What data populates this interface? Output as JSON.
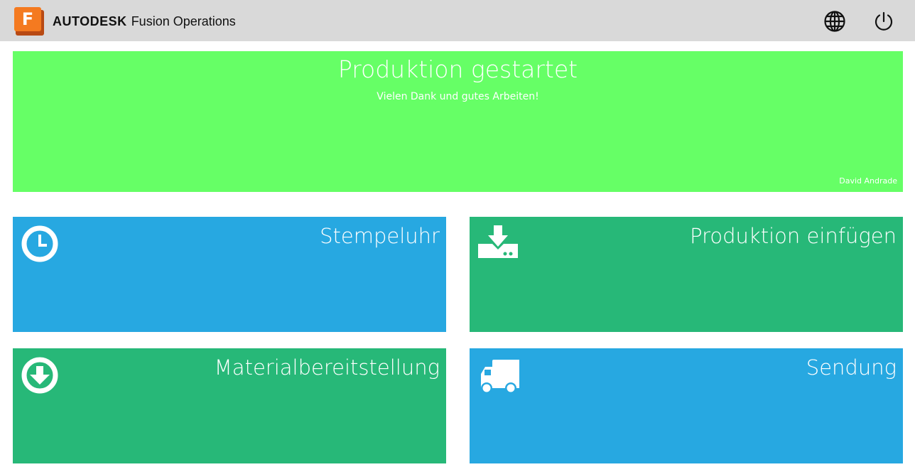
{
  "header": {
    "logo_letter": "F",
    "brand": "AUTODESK",
    "product": "Fusion Operations",
    "icons": [
      "globe-icon",
      "power-icon"
    ]
  },
  "banner": {
    "title": "Produktion gestartet",
    "subtitle": "Vielen Dank und gutes Arbeiten!",
    "user": "David Andrade",
    "color": "#66ff66"
  },
  "tiles": [
    {
      "label": "Stempeluhr",
      "icon": "clock-icon",
      "color": "#27a8e1"
    },
    {
      "label": "Produktion einfügen",
      "icon": "download-tray-icon",
      "color": "#27b878"
    },
    {
      "label": "Materialbereitstellung",
      "icon": "circle-arrow-down-icon",
      "color": "#27b878"
    },
    {
      "label": "Sendung",
      "icon": "truck-icon",
      "color": "#27a8e1"
    }
  ]
}
